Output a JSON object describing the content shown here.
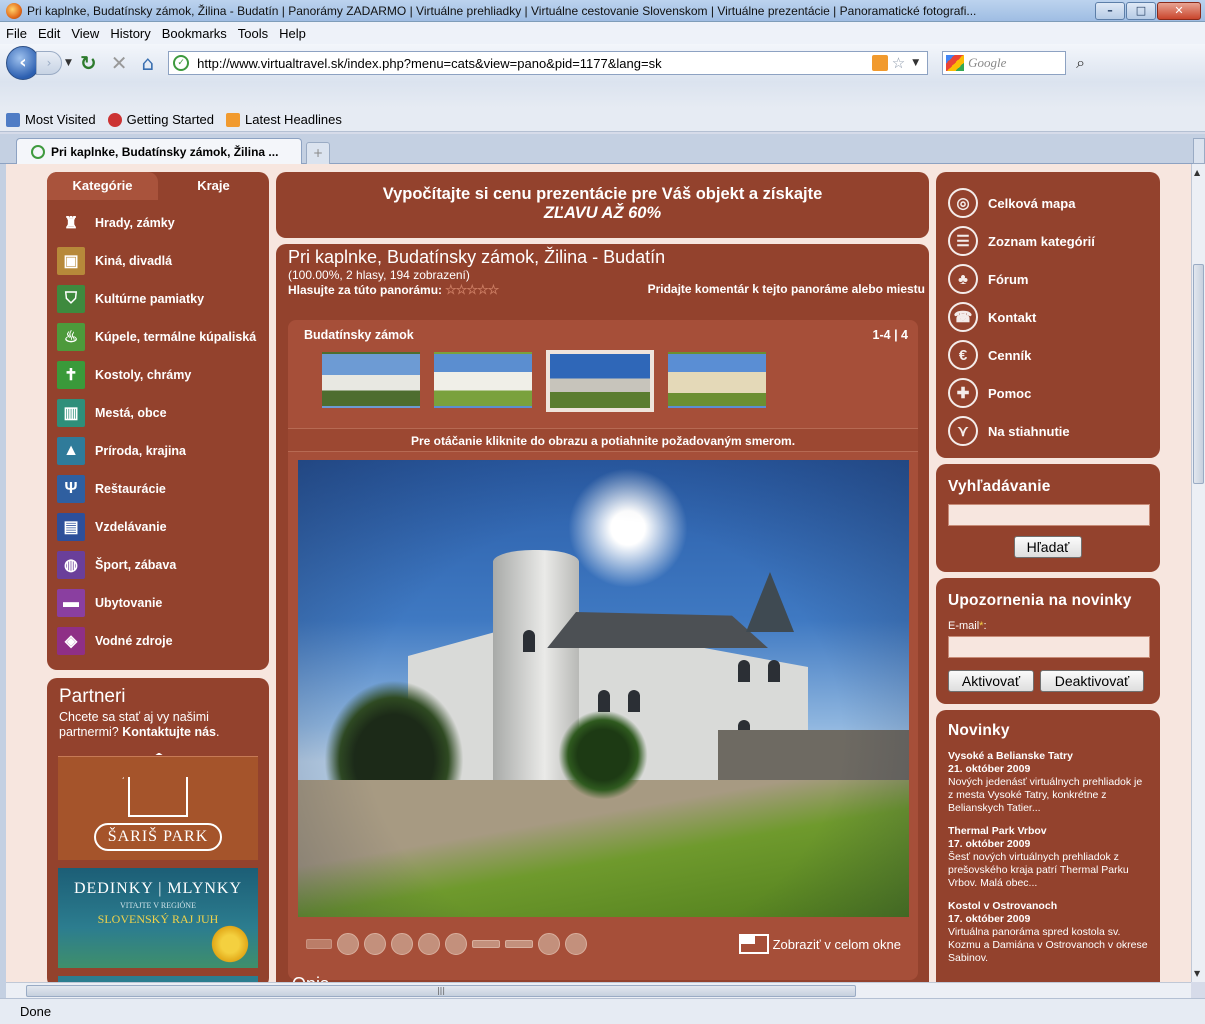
{
  "window": {
    "title": "Pri kaplnke, Budatínsky zámok, Žilina - Budatín | Panorámy ZADARMO | Virtuálne prehliadky | Virtuálne cestovanie Slovenskom | Virtuálne prezentácie | Panoramatické fotografi...",
    "min": "–",
    "max": "□",
    "close": "✕"
  },
  "menubar": [
    "File",
    "Edit",
    "View",
    "History",
    "Bookmarks",
    "Tools",
    "Help"
  ],
  "navbar": {
    "url": "http://www.virtualtravel.sk/index.php?menu=cats&view=pano&pid=1177&lang=sk",
    "search_placeholder": "Google"
  },
  "bookmarks": [
    "Most Visited",
    "Getting Started",
    "Latest Headlines"
  ],
  "tab": {
    "label": "Pri kaplnke, Budatínsky zámok, Žilina ..."
  },
  "status": "Done",
  "site": {
    "categories": {
      "tabs": [
        "Kategórie",
        "Kraje"
      ],
      "items": [
        {
          "label": "Hrady, zámky",
          "color": "#93422d",
          "icon": "castle-icon"
        },
        {
          "label": "Kiná, divadlá",
          "color": "#b7893a",
          "icon": "projector-icon"
        },
        {
          "label": "Kultúrne pamiatky",
          "color": "#3e8a3e",
          "icon": "shield-icon"
        },
        {
          "label": "Kúpele, termálne kúpaliská",
          "color": "#4d9a3b",
          "icon": "spa-icon"
        },
        {
          "label": "Kostoly, chrámy",
          "color": "#3a9a3a",
          "icon": "church-icon"
        },
        {
          "label": "Mestá, obce",
          "color": "#2f8f7a",
          "icon": "city-icon"
        },
        {
          "label": "Príroda, krajina",
          "color": "#2f7b9a",
          "icon": "mountain-icon"
        },
        {
          "label": "Reštaurácie",
          "color": "#2f5fa0",
          "icon": "cutlery-icon"
        },
        {
          "label": "Vzdelávanie",
          "color": "#2d4f9a",
          "icon": "book-icon"
        },
        {
          "label": "Šport, zábava",
          "color": "#6a3f9a",
          "icon": "racket-icon"
        },
        {
          "label": "Ubytovanie",
          "color": "#8a3fa0",
          "icon": "bed-icon"
        },
        {
          "label": "Vodné zdroje",
          "color": "#8f2f86",
          "icon": "water-icon"
        }
      ]
    },
    "partners": {
      "title": "Partneri",
      "text": "Chcete sa stať aj vy našimi partnermi?",
      "contact_link": "Kontaktujte nás",
      "saris": "ŠARIŠ PARK",
      "dm_l1": "DEDINKY | MLYNKY",
      "dm_l2": "VITAJTE V REGIÓNE",
      "dm_l3": "SLOVENSKÝ RAJ JUH"
    },
    "promo": {
      "line1": "Vypočítajte si cenu prezentácie pre Váš objekt a získajte",
      "line2": "ZĽAVU AŽ 60%"
    },
    "pano": {
      "title": "Pri kaplnke, Budatínsky zámok, Žilina - Budatín",
      "stats": "(100.00%, 2 hlasy, 194 zobrazení)",
      "vote_label": "Hlasujte za túto panorámu:",
      "stars": "☆☆☆☆☆",
      "rating_percent": 100,
      "comment_link": "Pridajte komentár k tejto panoráme alebo miestu",
      "gallery_title": "Budatínsky zámok",
      "gallery_count": "1-4 | 4",
      "selected_thumb": 3,
      "hint": "Pre otáčanie kliknite do obrazu a potiahnite požadovaným smerom.",
      "fullscreen": "Zobraziť v celom okne",
      "desc_heading": "Opis"
    },
    "rnav": [
      {
        "label": "Celková mapa",
        "icon": "globe-icon",
        "glyph": "◎"
      },
      {
        "label": "Zoznam kategórií",
        "icon": "list-icon",
        "glyph": "☰"
      },
      {
        "label": "Fórum",
        "icon": "people-icon",
        "glyph": "♣"
      },
      {
        "label": "Kontakt",
        "icon": "phone-icon",
        "glyph": "☎"
      },
      {
        "label": "Cenník",
        "icon": "euro-icon",
        "glyph": "€"
      },
      {
        "label": "Pomoc",
        "icon": "plus-icon",
        "glyph": "✚"
      },
      {
        "label": "Na stiahnutie",
        "icon": "download-icon",
        "glyph": "⋎"
      }
    ],
    "search": {
      "title": "Vyhľadávanie",
      "button": "Hľadať"
    },
    "alerts": {
      "title": "Upozornenia na novinky",
      "email_label": "E-mail",
      "req": "*",
      "colon": ":",
      "activate": "Aktivovať",
      "deactivate": "Deaktivovať"
    },
    "news": {
      "title": "Novinky",
      "items": [
        {
          "title": "Vysoké a Belianske Tatry",
          "date": "21. október 2009",
          "text": "Nových jedenásť virtuálnych prehliadok je z mesta Vysoké Tatry, konkrétne z Belianskych Tatier..."
        },
        {
          "title": "Thermal Park Vrbov",
          "date": "17. október 2009",
          "text": "Šesť nových virtuálnych prehliadok z prešovského kraja patrí Thermal Parku Vrbov. Malá obec..."
        },
        {
          "title": "Kostol v Ostrovanoch",
          "date": "17. október 2009",
          "text": "Virtuálna panoráma spred kostola sv. Kozmu a Damiána v Ostrovanoch v okrese Sabinov."
        }
      ]
    }
  }
}
